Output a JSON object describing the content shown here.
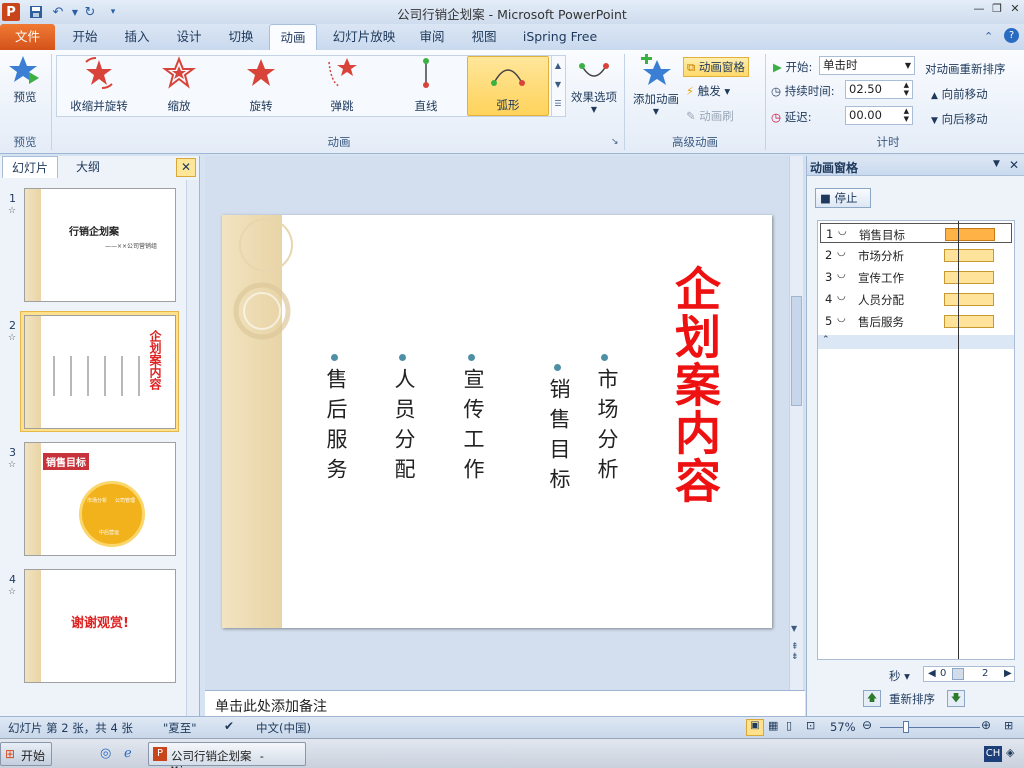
{
  "title_bar": {
    "title": "公司行销企划案 - Microsoft PowerPoint",
    "app_icon": "P"
  },
  "tabs": [
    "文件",
    "开始",
    "插入",
    "设计",
    "切换",
    "动画",
    "幻灯片放映",
    "审阅",
    "视图",
    "iSpring Free"
  ],
  "ribbon": {
    "preview_label": "预览",
    "preview_group": "预览",
    "effects": [
      "收缩并旋转",
      "缩放",
      "旋转",
      "弹跳",
      "直线",
      "弧形"
    ],
    "selected_effect": "弧形",
    "effect_options": "效果选项",
    "animation_group": "动画",
    "add_animation": "添加动画",
    "anim_pane_btn": "动画窗格",
    "trigger": "触发",
    "anim_painter": "动画刷",
    "advanced_group": "高级动画",
    "start_label": "开始:",
    "start_value": "单击时",
    "duration_label": "持续时间:",
    "duration_value": "02.50",
    "delay_label": "延迟:",
    "delay_value": "00.00",
    "reorder_title": "对动画重新排序",
    "move_earlier": "向前移动",
    "move_later": "向后移动",
    "timing_group": "计时"
  },
  "left_pane": {
    "tab_slides": "幻灯片",
    "tab_outline": "大纲",
    "thumbs": [
      {
        "num": "1",
        "title": "行销企划案",
        "sub": "——××公司营销组"
      },
      {
        "num": "2",
        "title": "企划案内容"
      },
      {
        "num": "3",
        "title": "销售目标",
        "c1": "市场分析",
        "c2": "公司管理",
        "c3": "中后营运"
      },
      {
        "num": "4",
        "title": "谢谢观赏!"
      }
    ]
  },
  "slide": {
    "title": "企划案内容",
    "columns": [
      "市场分析",
      "销售目标",
      "宣传工作",
      "人员分配",
      "售后服务"
    ]
  },
  "notes": {
    "placeholder": "单击此处添加备注"
  },
  "anim_pane": {
    "title": "动画窗格",
    "stop_button": "停止",
    "items": [
      {
        "num": "1",
        "name": "销售目标"
      },
      {
        "num": "2",
        "name": "市场分析"
      },
      {
        "num": "3",
        "name": "宣传工作"
      },
      {
        "num": "4",
        "name": "人员分配"
      },
      {
        "num": "5",
        "name": "售后服务"
      }
    ],
    "seconds_label": "秒",
    "timeline_start": "0",
    "timeline_end": "2",
    "reorder_label": "重新排序"
  },
  "status": {
    "slide_info": "幻灯片 第 2 张，共 4 张",
    "theme": "\"夏至\"",
    "language": "中文(中国)",
    "zoom": "57%"
  },
  "taskbar": {
    "start": "开始",
    "window": "公司行销企划案 - Mi...",
    "ime": "CH"
  },
  "colors": {
    "accent_file": "#e0621f",
    "slide_title_red": "#e11111",
    "selected_gold": "#ffd35c"
  }
}
